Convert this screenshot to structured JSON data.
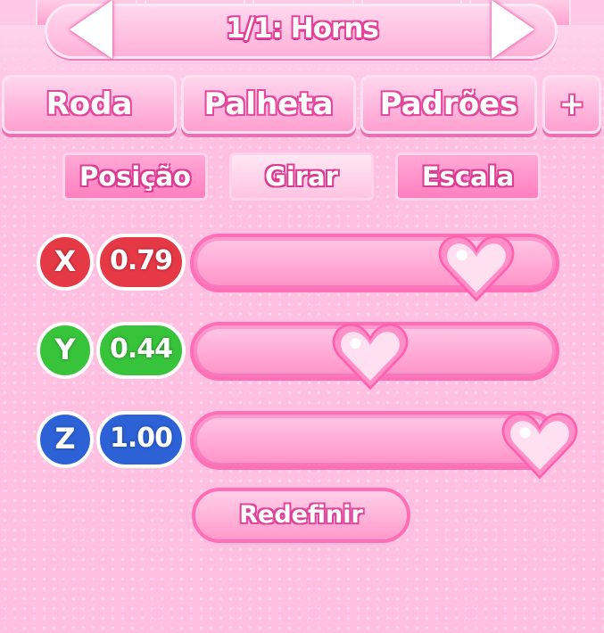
{
  "header": {
    "title": "1/1: Horns",
    "prev_icon": "arrow-left-icon",
    "next_icon": "arrow-right-icon"
  },
  "tabs": [
    {
      "label": "Roda"
    },
    {
      "label": "Palheta"
    },
    {
      "label": "Padrões"
    },
    {
      "label": "+"
    }
  ],
  "subtabs": [
    {
      "label": "Posição",
      "active": false
    },
    {
      "label": "Girar",
      "active": true
    },
    {
      "label": "Escala",
      "active": false
    }
  ],
  "sliders": [
    {
      "axis": "X",
      "value_text": "0.79",
      "value": 0.79,
      "color": "#e63946"
    },
    {
      "axis": "Y",
      "value_text": "0.44",
      "value": 0.44,
      "color": "#37c43a"
    },
    {
      "axis": "Z",
      "value_text": "1.00",
      "value": 1.0,
      "color": "#2c62d6"
    }
  ],
  "reset_label": "Redefinir",
  "colors": {
    "panel": "#ffbfe1",
    "accent": "#ff6fb8",
    "text_outline": "#e4479c"
  },
  "slider_knob_icon": "heart-icon"
}
